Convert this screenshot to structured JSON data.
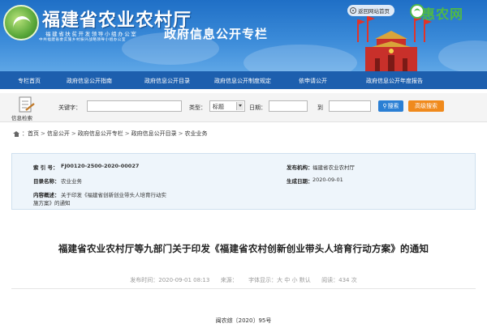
{
  "header": {
    "site_title": "福建省农业农村厅",
    "sub_line1": "福建省扶贫开发领导小组办公室",
    "sub_line2": "中共福建省委实施乡村振兴战略领导小组办公室",
    "section_title": "政府信息公开专栏",
    "return_home": "返回网站首页",
    "watermark_text": "惠农网"
  },
  "nav": {
    "items": [
      "专栏首页",
      "政府信息公开指南",
      "政府信息公开目录",
      "政府信息公开制度规定",
      "依申请公开",
      "政府信息公开年度报告"
    ]
  },
  "search": {
    "icon_label": "信息检索",
    "keyword_label": "关键字：",
    "keyword_value": "",
    "type_label": "类型：",
    "type_selected": "标题",
    "date_label": "日期：",
    "date_from": "",
    "to_label": "到",
    "date_to": "",
    "search_button": "搜索",
    "advanced_button": "高级搜索"
  },
  "breadcrumb": {
    "items": [
      "首页",
      "信息公开",
      "政府信息公开专栏",
      "政府信息公开目录",
      "农业业务"
    ],
    "separator": ">"
  },
  "info": {
    "index_label": "索 引 号：",
    "index_value": "FJ00120-2500-2020-00027",
    "publisher_label": "发布机构：",
    "publisher_value": "福建省农业农村厅",
    "category_label": "目录名称：",
    "category_value": "农业业务",
    "date_label": "生成日期：",
    "date_value": "2020-09-01",
    "summary_label": "内容概述：",
    "summary_value_line1": "关于印发《福建省创新创业带头人培育行动实",
    "summary_value_line2": "施方案》的通知"
  },
  "article": {
    "title": "福建省农业农村厅等九部门关于印发《福建省农村创新创业带头人培育行动方案》的通知",
    "publish_label": "发布时间：",
    "publish_time": "2020-09-01 08:13",
    "source_label": "来源：",
    "font_label": "字体显示：",
    "font_large": "大",
    "font_medium": "中",
    "font_small": "小",
    "default_label": "默认",
    "views_label": "阅读：",
    "views_count": "434",
    "views_unit": "次",
    "doc_number": "闽农综〔2020〕95号"
  },
  "colors": {
    "banner": "#2a7bd0",
    "nav": "#1d5fae",
    "search_button": "#2a7fd4",
    "advanced_button": "#f08a1c",
    "info_bg": "#eef5fb"
  }
}
